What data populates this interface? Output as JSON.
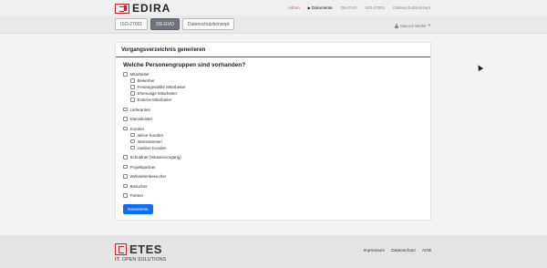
{
  "header": {
    "brand": "EDIRA",
    "nav": {
      "admin": "Admin",
      "documents": "Dokumente",
      "dsgvo": "DS-GVO",
      "iso": "ISO-27001",
      "datenschutz": "Datenschutzkonzept"
    }
  },
  "subbar": {
    "tabs": [
      "ISO-27001",
      "DS-GVO",
      "Datenschutzkonzept"
    ],
    "active_tab": "DS-GVO",
    "user": "Marcus Weiler"
  },
  "card": {
    "title": "Vorgangsverzeichnis generieren",
    "question": "Welche Personengruppen sind vorhanden?",
    "groups": {
      "mitarbeiter": "Mitarbeiter",
      "bewerber": "Bewerber",
      "festangestellte": "Festangestellte Mitarbeiter",
      "ehemalige": "Ehemalige Mitarbeiter",
      "externe": "Externe Mitarbeiter",
      "lieferanten": "Lieferanten",
      "dienstleister": "Dienstleister",
      "kunden": "Kunden",
      "aktive": "aktive Kunden",
      "interessenten": "Interessenten",
      "inaktive": "inaktive Kunden",
      "schuldner": "Schuldner (Inkassovorgang)",
      "projektpartner": "Projektpartner",
      "webseitenbesucher": "Webseitenbesucher",
      "besucher": "Besucher",
      "partner": "Partner"
    },
    "submit": "Generieren"
  },
  "footer": {
    "brand": "ETES",
    "sub_it": "IT.",
    "sub_rest": "OPEN SOLUTIONS",
    "links": {
      "impressum": "Impressum",
      "datenschutz": "Datenschutz",
      "agb": "AGB"
    }
  }
}
